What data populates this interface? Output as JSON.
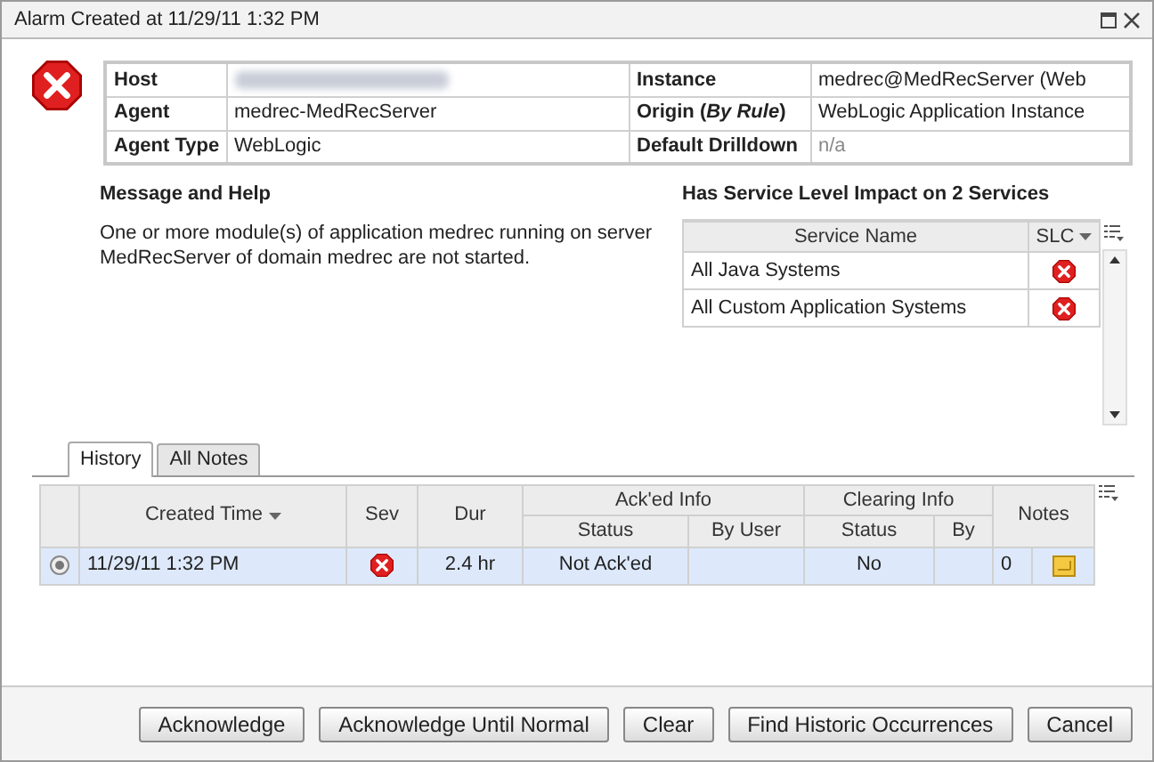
{
  "window": {
    "title": "Alarm Created at 11/29/11 1:32 PM"
  },
  "details": [
    {
      "label": "Host",
      "kind": "blurred"
    },
    {
      "label": "Agent",
      "value": "medrec-MedRecServer",
      "kind": "text"
    },
    {
      "label": "Agent Type",
      "value": "WebLogic",
      "kind": "text"
    },
    {
      "label": "Instance",
      "value": "medrec@MedRecServer (Web",
      "kind": "text"
    },
    {
      "label": "Origin (*By Rule*)",
      "value": "WebLogic Application Instance",
      "kind": "text"
    },
    {
      "label": "Default Drilldown",
      "value": "n/a",
      "kind": "muted"
    }
  ],
  "message": {
    "heading": "Message and Help",
    "text": "One or more module(s) of application medrec running on server MedRecServer of domain medrec are not started."
  },
  "services": {
    "heading": "Has Service Level Impact on 2 Services",
    "columns": [
      "Service Name",
      "SLC"
    ],
    "rows": [
      {
        "name": "All Java Systems"
      },
      {
        "name": "All Custom Application Systems"
      }
    ]
  },
  "tabs": [
    {
      "label": "History",
      "selected": true
    },
    {
      "label": "All Notes",
      "selected": false
    }
  ],
  "history": {
    "columns": {
      "created": "Created Time",
      "sev": "Sev",
      "dur": "Dur",
      "ack": "Ack'ed Info",
      "ack_status": "Status",
      "ack_user": "By User",
      "clear": "Clearing Info",
      "clear_status": "Status",
      "clear_by": "By",
      "notes": "Notes"
    },
    "rows": [
      {
        "selected": true,
        "created": "11/29/11 1:32 PM",
        "dur": "2.4 hr",
        "ack_status": "Not Ack'ed",
        "clear_status": "No",
        "notes": "0"
      }
    ]
  },
  "buttons": [
    "Acknowledge",
    "Acknowledge Until Normal",
    "Clear",
    "Find Historic Occurrences",
    "Cancel"
  ]
}
